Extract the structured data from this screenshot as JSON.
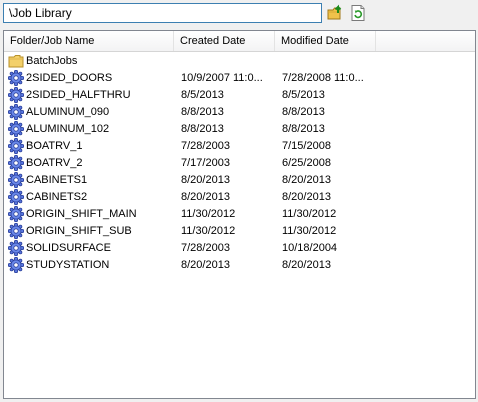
{
  "path": {
    "value": "\\Job Library"
  },
  "toolbar": {
    "up_icon": "folder-up-icon",
    "refresh_icon": "refresh-icon"
  },
  "columns": {
    "name": "Folder/Job Name",
    "created": "Created Date",
    "modified": "Modified Date"
  },
  "rows": [
    {
      "type": "folder",
      "name": "BatchJobs",
      "created": "",
      "modified": ""
    },
    {
      "type": "job",
      "name": "2SIDED_DOORS",
      "created": "10/9/2007 11:0...",
      "modified": "7/28/2008 11:0..."
    },
    {
      "type": "job",
      "name": "2SIDED_HALFTHRU",
      "created": "8/5/2013",
      "modified": "8/5/2013"
    },
    {
      "type": "job",
      "name": "ALUMINUM_090",
      "created": "8/8/2013",
      "modified": "8/8/2013"
    },
    {
      "type": "job",
      "name": "ALUMINUM_102",
      "created": "8/8/2013",
      "modified": "8/8/2013"
    },
    {
      "type": "job",
      "name": "BOATRV_1",
      "created": "7/28/2003",
      "modified": "7/15/2008"
    },
    {
      "type": "job",
      "name": "BOATRV_2",
      "created": "7/17/2003",
      "modified": "6/25/2008"
    },
    {
      "type": "job",
      "name": "CABINETS1",
      "created": "8/20/2013",
      "modified": "8/20/2013"
    },
    {
      "type": "job",
      "name": "CABINETS2",
      "created": "8/20/2013",
      "modified": "8/20/2013"
    },
    {
      "type": "job",
      "name": "ORIGIN_SHIFT_MAIN",
      "created": "11/30/2012",
      "modified": "11/30/2012"
    },
    {
      "type": "job",
      "name": "ORIGIN_SHIFT_SUB",
      "created": "11/30/2012",
      "modified": "11/30/2012"
    },
    {
      "type": "job",
      "name": "SOLIDSURFACE",
      "created": "7/28/2003",
      "modified": "10/18/2004"
    },
    {
      "type": "job",
      "name": "STUDYSTATION",
      "created": "8/20/2013",
      "modified": "8/20/2013"
    }
  ],
  "colors": {
    "accent_border": "#3c7fb1",
    "folder_yellow": "#f3d06a",
    "gear_blue": "#4f6fd8"
  }
}
